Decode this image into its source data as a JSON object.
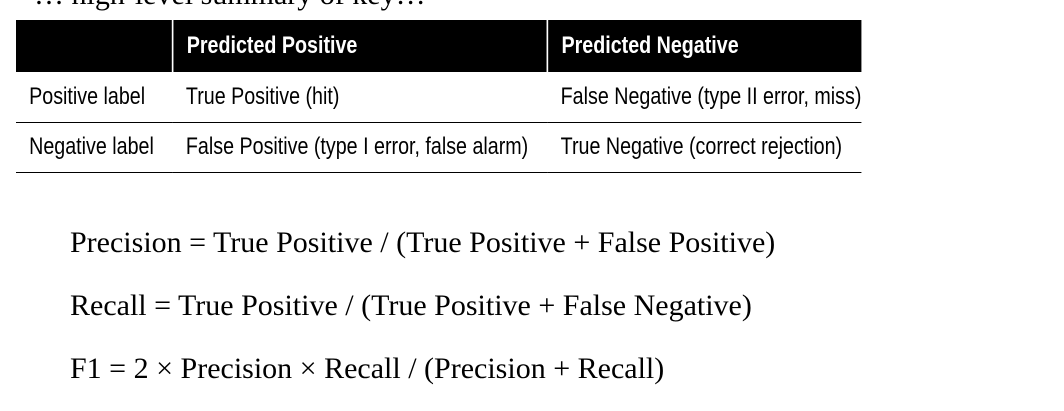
{
  "cut_text": "… high-level summary of key…",
  "table": {
    "headers": [
      "",
      "Predicted Positive",
      "Predicted Negative"
    ],
    "rows": [
      {
        "label": "Positive label",
        "predicted_positive": "True Positive (hit)",
        "predicted_negative": "False Negative (type II error, miss)"
      },
      {
        "label": "Negative label",
        "predicted_positive": "False Positive (type I error, false alarm)",
        "predicted_negative": "True Negative (correct rejection)"
      }
    ]
  },
  "formulas": [
    "Precision = True Positive / (True Positive + False Positive)",
    "Recall = True Positive / (True Positive + False Negative)",
    "F1 = 2 × Precision × Recall / (Precision + Recall)"
  ]
}
